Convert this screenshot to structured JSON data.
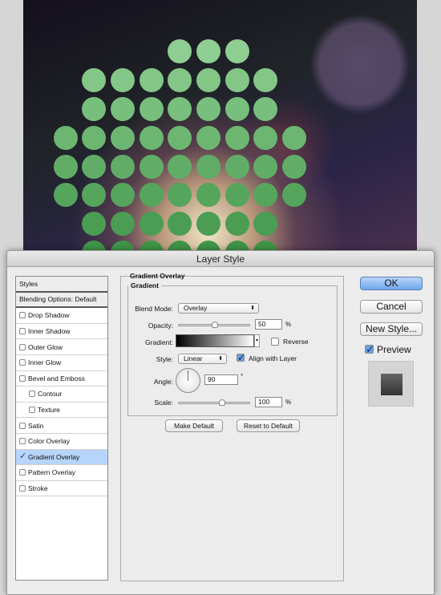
{
  "canvas": {
    "dot_rows": [
      [
        4,
        5,
        6
      ],
      [
        1,
        2,
        3,
        4,
        5,
        6,
        7
      ],
      [
        1,
        2,
        3,
        4,
        5,
        6,
        7
      ],
      [
        0,
        1,
        2,
        3,
        4,
        5,
        6,
        7,
        8
      ],
      [
        0,
        1,
        2,
        3,
        4,
        5,
        6,
        7,
        8
      ],
      [
        0,
        1,
        2,
        3,
        4,
        5,
        6,
        7,
        8
      ],
      [
        1,
        2,
        3,
        4,
        5,
        6,
        7
      ],
      [
        1,
        2,
        3,
        4,
        5,
        6,
        7
      ]
    ],
    "dot_color_top": "#8fce92",
    "dot_color_bottom": "#3f9548"
  },
  "dialog": {
    "title": "Layer Style",
    "styles_header": "Styles",
    "blending": "Blending Options: Default",
    "styles": [
      {
        "label": "Drop Shadow",
        "checked": false,
        "sub": false
      },
      {
        "label": "Inner Shadow",
        "checked": false,
        "sub": false
      },
      {
        "label": "Outer Glow",
        "checked": false,
        "sub": false
      },
      {
        "label": "Inner Glow",
        "checked": false,
        "sub": false
      },
      {
        "label": "Bevel and Emboss",
        "checked": false,
        "sub": false
      },
      {
        "label": "Contour",
        "checked": false,
        "sub": true
      },
      {
        "label": "Texture",
        "checked": false,
        "sub": true
      },
      {
        "label": "Satin",
        "checked": false,
        "sub": false
      },
      {
        "label": "Color Overlay",
        "checked": false,
        "sub": false
      },
      {
        "label": "Gradient Overlay",
        "checked": true,
        "sub": false,
        "selected": true
      },
      {
        "label": "Pattern Overlay",
        "checked": false,
        "sub": false
      },
      {
        "label": "Stroke",
        "checked": false,
        "sub": false
      }
    ],
    "section_title": "Gradient Overlay",
    "group_title": "Gradient",
    "blend_mode_label": "Blend Mode:",
    "blend_mode": "Overlay",
    "opacity_label": "Opacity:",
    "opacity": "50",
    "opacity_unit": "%",
    "gradient_label": "Gradient:",
    "reverse_label": "Reverse",
    "reverse_checked": false,
    "style_label": "Style:",
    "style": "Linear",
    "align_label": "Align with Layer",
    "align_checked": true,
    "angle_label": "Angle:",
    "angle": "90",
    "angle_unit": "°",
    "scale_label": "Scale:",
    "scale": "100",
    "scale_unit": "%",
    "make_default": "Make Default",
    "reset_default": "Reset to Default",
    "ok": "OK",
    "cancel": "Cancel",
    "new_style": "New Style...",
    "preview_label": "Preview",
    "preview_checked": true,
    "accent": "#7fb4f2"
  }
}
